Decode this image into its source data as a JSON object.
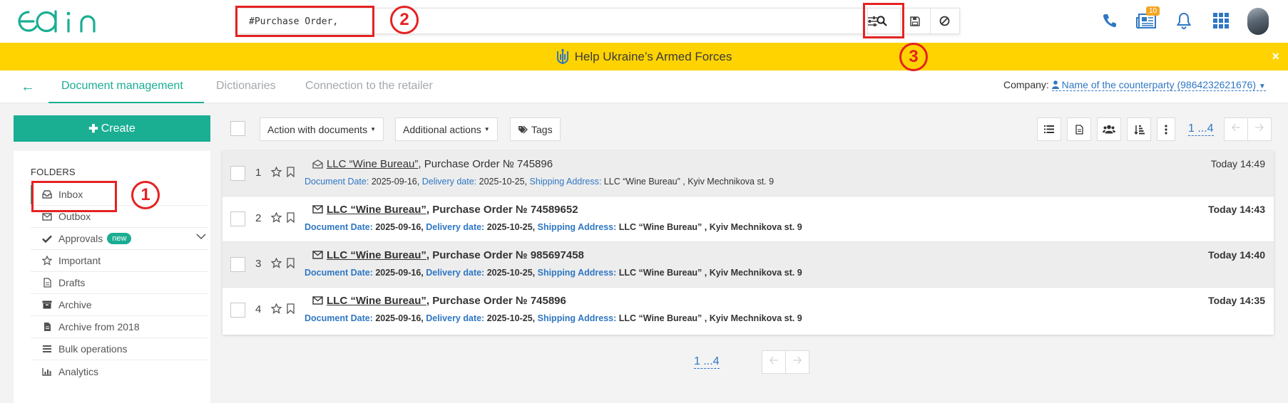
{
  "header": {
    "logo_text": "edin",
    "search_value": "#Purchase Order,",
    "notifications_badge": "10"
  },
  "banner": {
    "text": "Help Ukraine’s Armed Forces",
    "close": "×"
  },
  "subnav": {
    "back": "←",
    "tabs": [
      {
        "label": "Document management",
        "active": true
      },
      {
        "label": "Dictionaries",
        "active": false
      },
      {
        "label": "Connection to the retailer",
        "active": false
      }
    ],
    "company_label": "Company:",
    "company_value": "Name of the counterparty (9864232621676)"
  },
  "sidebar": {
    "create_label": "Create",
    "folders_title": "FOLDERS",
    "items": [
      {
        "label": "Inbox",
        "icon": "inbox-icon",
        "active": true
      },
      {
        "label": "Outbox",
        "icon": "envelope-icon"
      },
      {
        "label": "Approvals",
        "icon": "check-icon",
        "badge": "new"
      },
      {
        "label": "Important",
        "icon": "star-icon"
      },
      {
        "label": "Drafts",
        "icon": "file-icon"
      },
      {
        "label": "Archive",
        "icon": "archive-icon"
      },
      {
        "label": "Archive from 2018",
        "icon": "file-text-icon"
      },
      {
        "label": "Bulk operations",
        "icon": "tasks-icon"
      },
      {
        "label": "Analytics",
        "icon": "bar-chart-icon"
      }
    ]
  },
  "toolbar": {
    "action_with_documents": "Action with documents",
    "additional_actions": "Additional actions",
    "tags": "Tags",
    "pager": "1 ...4"
  },
  "documents": [
    {
      "num": "1",
      "party": "LLC “Wine Bureau”",
      "title_rest": ", Purchase Order № 745896",
      "doc_date_label": "Document Date:",
      "doc_date": "2025-09-16,",
      "delivery_label": "Delivery date:",
      "delivery": "2025-10-25,",
      "shipping_label": "Shipping Address:",
      "shipping": "LLC “Wine Bureau” , Kyiv Mechnikova st. 9",
      "time": "Today 14:49",
      "read": true
    },
    {
      "num": "2",
      "party": "LLC “Wine Bureau”",
      "title_rest": ", Purchase Order № 74589652",
      "doc_date_label": "Document Date:",
      "doc_date": "2025-09-16,",
      "delivery_label": "Delivery date:",
      "delivery": "2025-10-25,",
      "shipping_label": "Shipping Address:",
      "shipping": "LLC “Wine Bureau” , Kyiv Mechnikova st. 9",
      "time": "Today 14:43",
      "read": false
    },
    {
      "num": "3",
      "party": "LLC “Wine Bureau”",
      "title_rest": ", Purchase Order № 985697458",
      "doc_date_label": "Document Date:",
      "doc_date": "2025-09-16,",
      "delivery_label": "Delivery date:",
      "delivery": "2025-10-25,",
      "shipping_label": "Shipping Address:",
      "shipping": "LLC “Wine Bureau” , Kyiv Mechnikova st. 9",
      "time": "Today 14:40",
      "read": false
    },
    {
      "num": "4",
      "party": "LLC “Wine Bureau”",
      "title_rest": ", Purchase Order № 745896",
      "doc_date_label": "Document Date:",
      "doc_date": "2025-09-16,",
      "delivery_label": "Delivery date:",
      "delivery": "2025-10-25,",
      "shipping_label": "Shipping Address:",
      "shipping": "LLC “Wine Bureau” , Kyiv Mechnikova st. 9",
      "time": "Today 14:35",
      "read": false
    }
  ],
  "bottom_pager": "1 ...4",
  "annotations": [
    "1",
    "2",
    "3"
  ],
  "colors": {
    "brand": "#1aae93",
    "banner": "#fed300",
    "link": "#2f77c3",
    "annotation": "#e52222"
  }
}
